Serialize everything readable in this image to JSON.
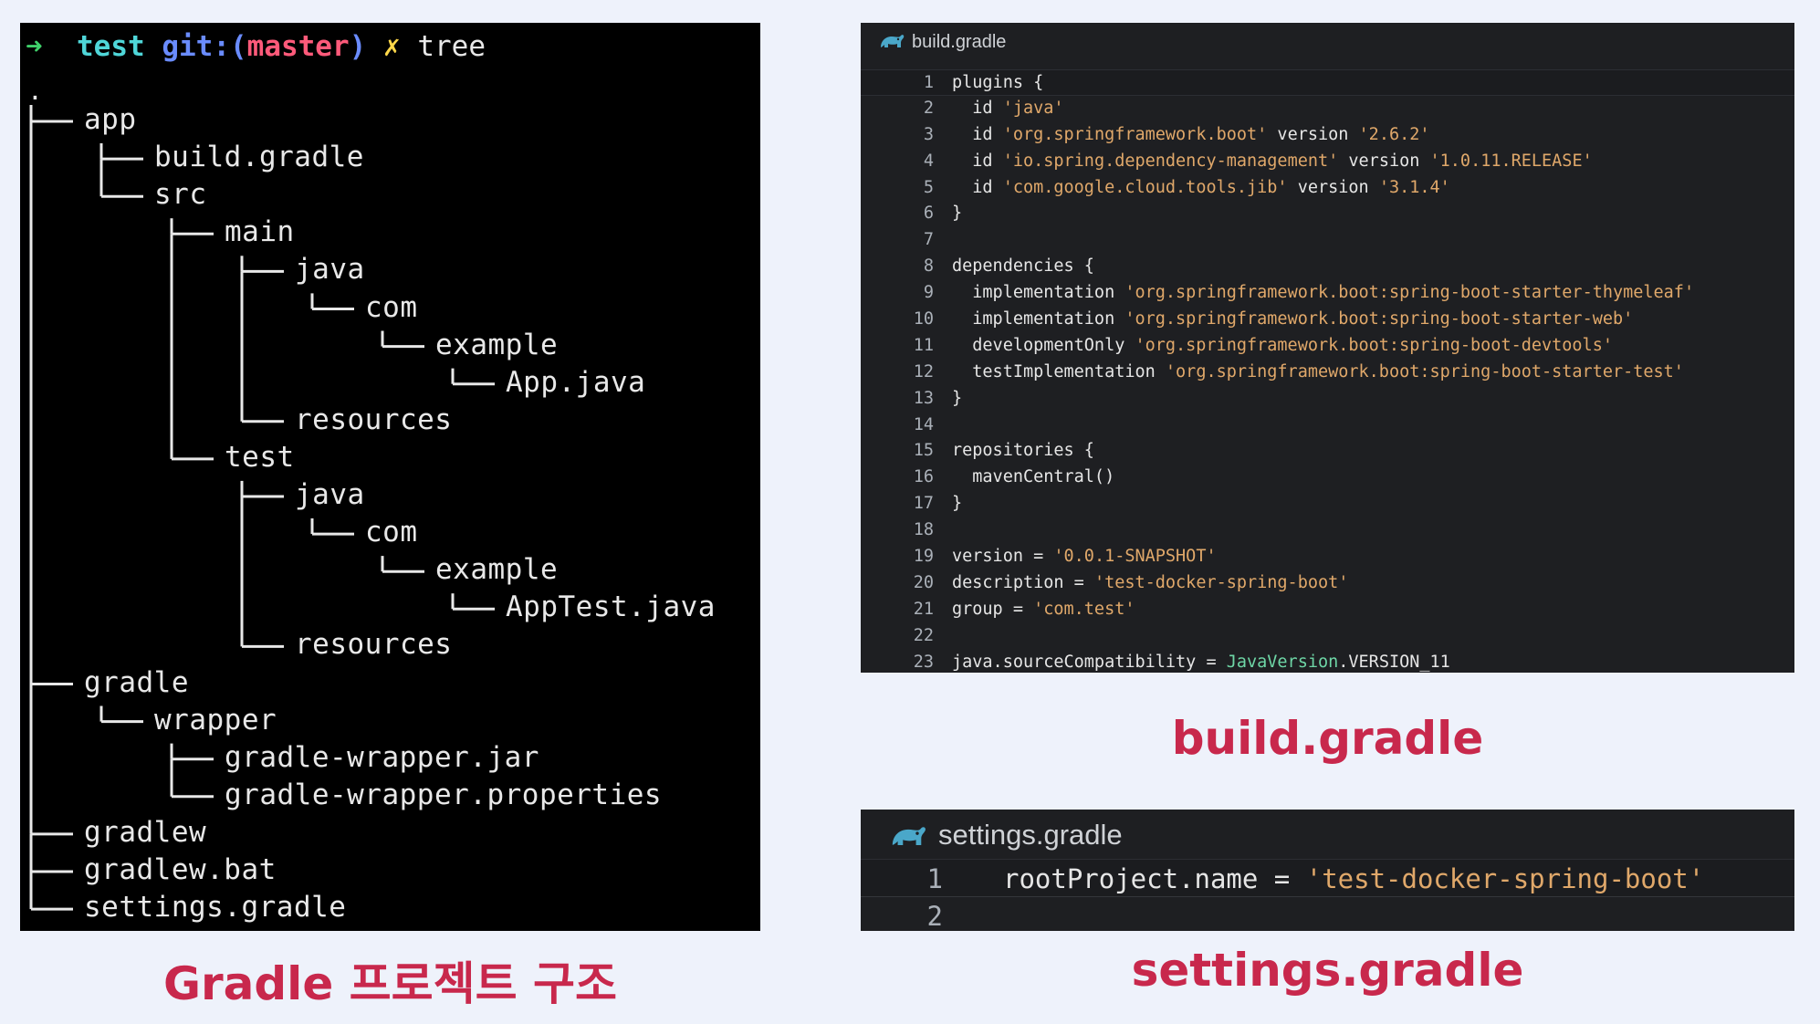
{
  "terminal": {
    "prompt_arrow": "➜",
    "prompt_dir": "test",
    "prompt_git": "git:(",
    "prompt_branch": "master",
    "prompt_git_close": ")",
    "prompt_dirty": "✗",
    "command": "tree",
    "root": ".",
    "tree": [
      {
        "label": "app",
        "depth": 0
      },
      {
        "label": "build.gradle",
        "depth": 1
      },
      {
        "label": "src",
        "depth": 1
      },
      {
        "label": "main",
        "depth": 2
      },
      {
        "label": "java",
        "depth": 3
      },
      {
        "label": "com",
        "depth": 4
      },
      {
        "label": "example",
        "depth": 5
      },
      {
        "label": "App.java",
        "depth": 6
      },
      {
        "label": "resources",
        "depth": 3
      },
      {
        "label": "test",
        "depth": 2
      },
      {
        "label": "java",
        "depth": 3
      },
      {
        "label": "com",
        "depth": 4
      },
      {
        "label": "example",
        "depth": 5
      },
      {
        "label": "AppTest.java",
        "depth": 6
      },
      {
        "label": "resources",
        "depth": 3
      },
      {
        "label": "gradle",
        "depth": 0
      },
      {
        "label": "wrapper",
        "depth": 1
      },
      {
        "label": "gradle-wrapper.jar",
        "depth": 2
      },
      {
        "label": "gradle-wrapper.properties",
        "depth": 2
      },
      {
        "label": "gradlew",
        "depth": 0
      },
      {
        "label": "gradlew.bat",
        "depth": 0
      },
      {
        "label": "settings.gradle",
        "depth": 0
      }
    ]
  },
  "build_editor": {
    "title": "build.gradle",
    "icon": "gradle-elephant-icon",
    "lines": [
      {
        "n": "1",
        "tokens": [
          [
            "kw",
            "plugins {"
          ]
        ]
      },
      {
        "n": "2",
        "tokens": [
          [
            "kw",
            "  id "
          ],
          [
            "str",
            "'java'"
          ]
        ]
      },
      {
        "n": "3",
        "tokens": [
          [
            "kw",
            "  id "
          ],
          [
            "str",
            "'org.springframework.boot'"
          ],
          [
            "kw",
            " version "
          ],
          [
            "str",
            "'2.6.2'"
          ]
        ]
      },
      {
        "n": "4",
        "tokens": [
          [
            "kw",
            "  id "
          ],
          [
            "str",
            "'io.spring.dependency-management'"
          ],
          [
            "kw",
            " version "
          ],
          [
            "str",
            "'1.0.11.RELEASE'"
          ]
        ]
      },
      {
        "n": "5",
        "tokens": [
          [
            "kw",
            "  id "
          ],
          [
            "str",
            "'com.google.cloud.tools.jib'"
          ],
          [
            "kw",
            " version "
          ],
          [
            "str",
            "'3.1.4'"
          ]
        ]
      },
      {
        "n": "6",
        "tokens": [
          [
            "kw",
            "}"
          ]
        ]
      },
      {
        "n": "7",
        "tokens": []
      },
      {
        "n": "8",
        "tokens": [
          [
            "kw",
            "dependencies {"
          ]
        ]
      },
      {
        "n": "9",
        "tokens": [
          [
            "kw",
            "  implementation "
          ],
          [
            "str",
            "'org.springframework.boot:spring-boot-starter-thymeleaf'"
          ]
        ]
      },
      {
        "n": "10",
        "tokens": [
          [
            "kw",
            "  implementation "
          ],
          [
            "str",
            "'org.springframework.boot:spring-boot-starter-web'"
          ]
        ]
      },
      {
        "n": "11",
        "tokens": [
          [
            "kw",
            "  developmentOnly "
          ],
          [
            "str",
            "'org.springframework.boot:spring-boot-devtools'"
          ]
        ]
      },
      {
        "n": "12",
        "tokens": [
          [
            "kw",
            "  testImplementation "
          ],
          [
            "str",
            "'org.springframework.boot:spring-boot-starter-test'"
          ]
        ]
      },
      {
        "n": "13",
        "tokens": [
          [
            "kw",
            "}"
          ]
        ]
      },
      {
        "n": "14",
        "tokens": []
      },
      {
        "n": "15",
        "tokens": [
          [
            "kw",
            "repositories {"
          ]
        ]
      },
      {
        "n": "16",
        "tokens": [
          [
            "kw",
            "  mavenCentral()"
          ]
        ]
      },
      {
        "n": "17",
        "tokens": [
          [
            "kw",
            "}"
          ]
        ]
      },
      {
        "n": "18",
        "tokens": []
      },
      {
        "n": "19",
        "tokens": [
          [
            "kw",
            "version = "
          ],
          [
            "str",
            "'0.0.1-SNAPSHOT'"
          ]
        ]
      },
      {
        "n": "20",
        "tokens": [
          [
            "kw",
            "description = "
          ],
          [
            "str",
            "'test-docker-spring-boot'"
          ]
        ]
      },
      {
        "n": "21",
        "tokens": [
          [
            "kw",
            "group = "
          ],
          [
            "str",
            "'com.test'"
          ]
        ]
      },
      {
        "n": "22",
        "tokens": []
      },
      {
        "n": "23",
        "tokens": [
          [
            "kw",
            "java.sourceCompatibility = "
          ],
          [
            "type",
            "JavaVersion"
          ],
          [
            "kw",
            ".VERSION_11"
          ]
        ]
      }
    ]
  },
  "settings_editor": {
    "title": "settings.gradle",
    "icon": "gradle-elephant-icon",
    "lines": [
      {
        "n": "1",
        "tokens": [
          [
            "kw",
            "rootProject.name = "
          ],
          [
            "str",
            "'test-docker-spring-boot'"
          ]
        ]
      },
      {
        "n": "2",
        "tokens": []
      }
    ]
  },
  "captions": {
    "tree": "Gradle 프로젝트 구조",
    "build": "build.gradle",
    "settings": "settings.gradle"
  },
  "colors": {
    "caption": "#c8284c",
    "string": "#e0a86a",
    "type": "#6ed6a6",
    "prompt_arrow": "#3fd06a",
    "prompt_dir": "#4fd6d8",
    "prompt_git": "#6a8cff",
    "prompt_branch": "#ff5a7a"
  }
}
